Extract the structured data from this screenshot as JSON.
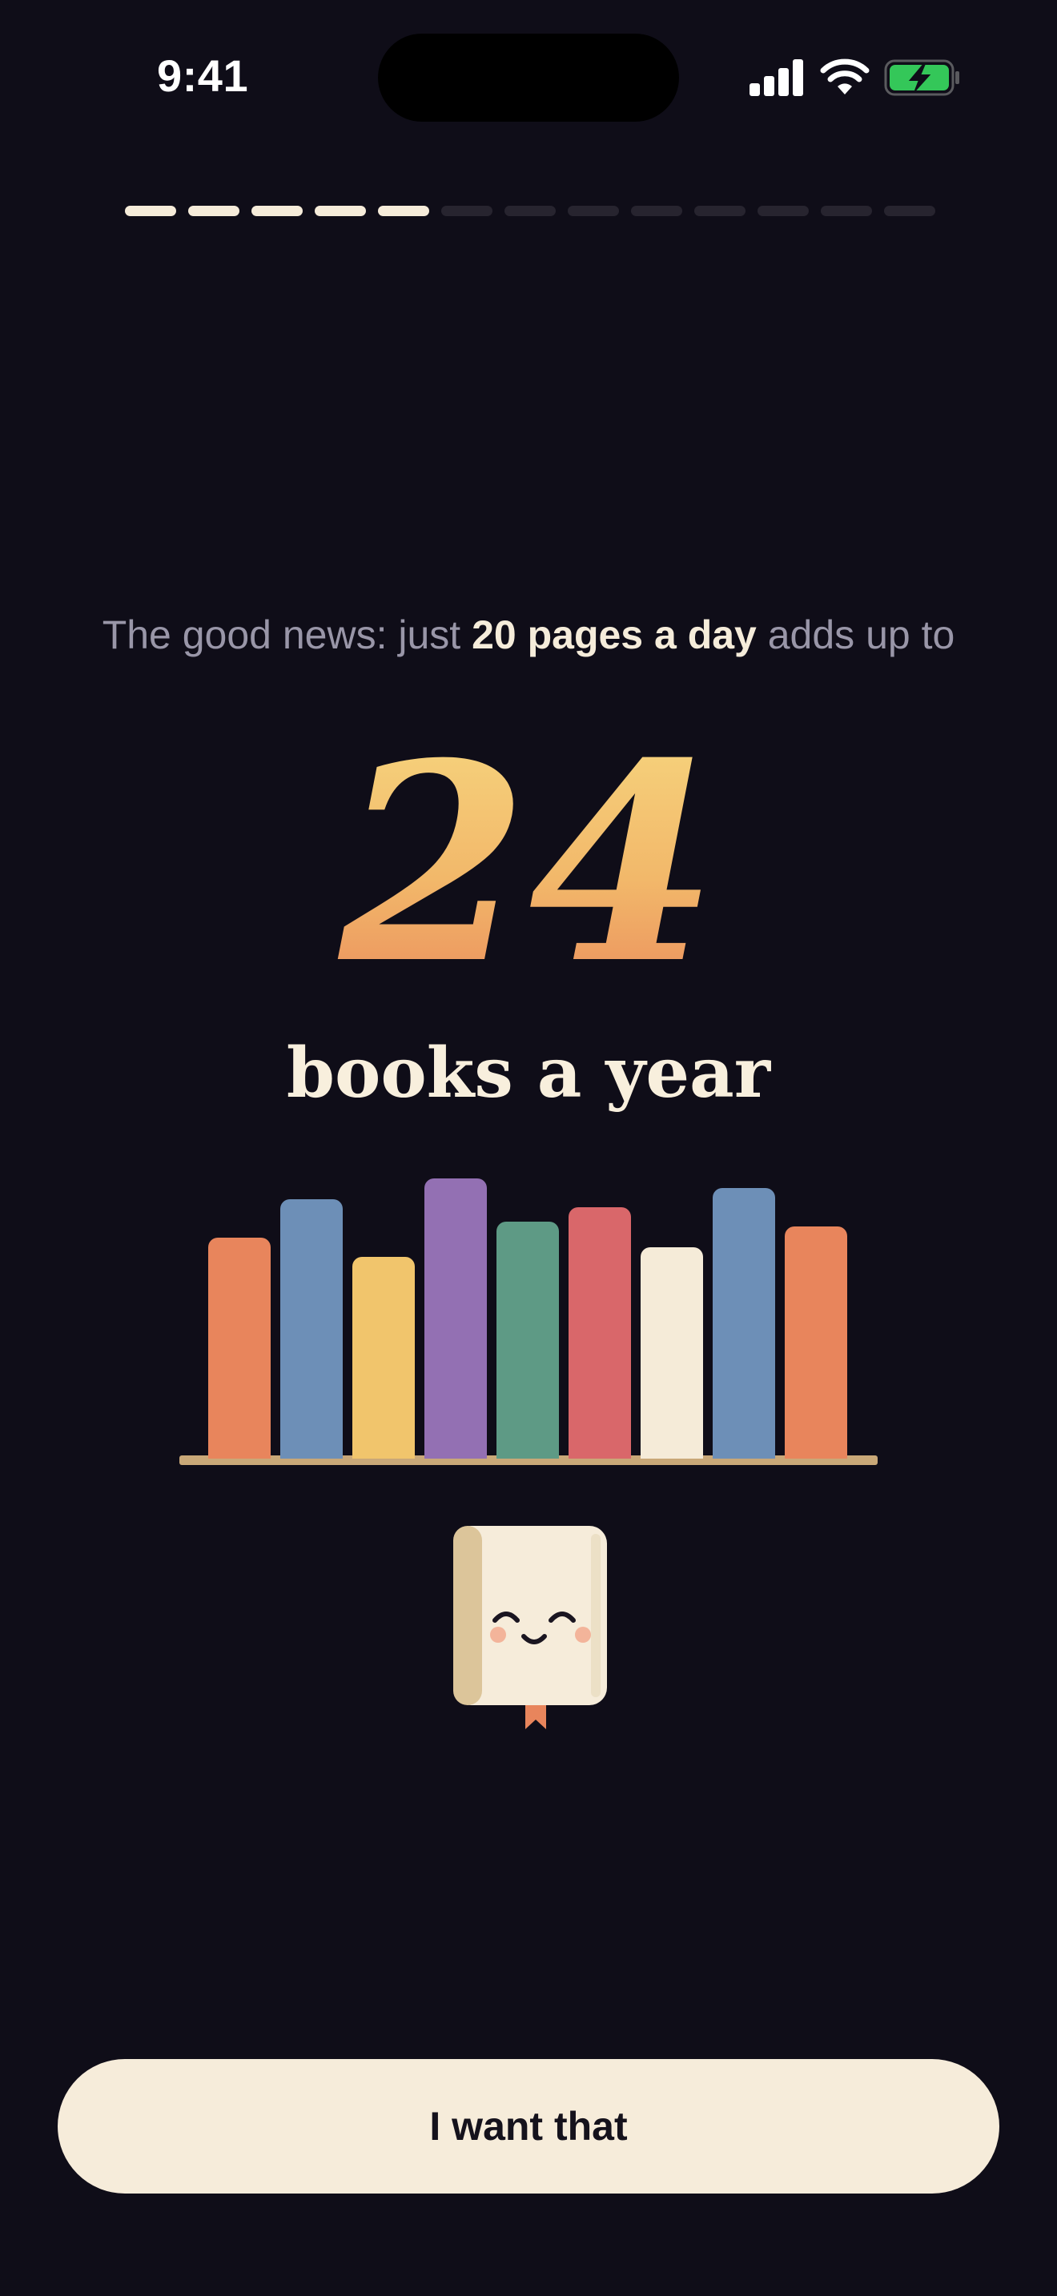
{
  "status_bar": {
    "time": "9:41",
    "icons": [
      "cellular-signal-icon",
      "wifi-icon",
      "battery-charging-icon"
    ],
    "battery_color": "#34c759"
  },
  "progress": {
    "total_steps": 13,
    "completed_steps": 5,
    "active_color": "#f6ecda",
    "inactive_color": "#27242f"
  },
  "headline": {
    "prefix": "The good news: just ",
    "highlight": "20 pages a day",
    "suffix": " adds up to"
  },
  "stat": {
    "value": "24",
    "unit": "books a year"
  },
  "bookshelf": {
    "books": [
      {
        "color": "#e8855c"
      },
      {
        "color": "#6d8fb7"
      },
      {
        "color": "#f1c56c"
      },
      {
        "color": "#9370b3"
      },
      {
        "color": "#5e9a85"
      },
      {
        "color": "#d9676a"
      },
      {
        "color": "#f5ebd8"
      },
      {
        "color": "#6d8fb7"
      },
      {
        "color": "#e8855c"
      }
    ],
    "shelf_color": "#c9a878"
  },
  "mascot": {
    "name": "smiling-book-mascot-icon",
    "cover_color": "#f6ecda",
    "spine_color": "#dcc59a",
    "bookmark_color": "#e8855c"
  },
  "cta": {
    "label": "I want that"
  },
  "theme": {
    "background": "#0f0d18",
    "accent_gradient": [
      "#f6d57e",
      "#ea8c5c"
    ]
  }
}
